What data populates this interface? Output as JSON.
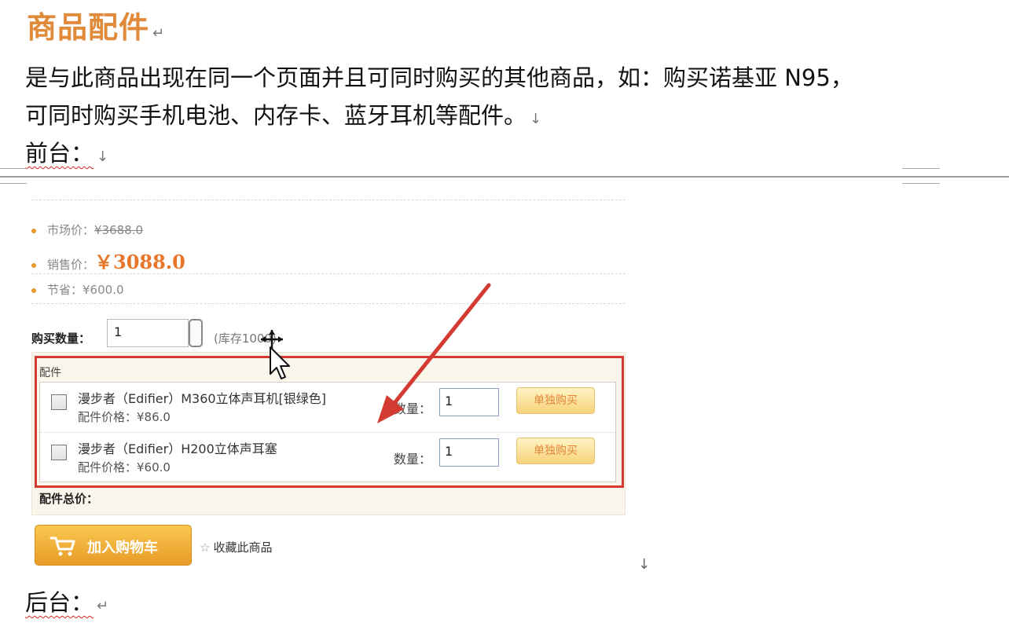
{
  "doc": {
    "heading": "商品配件",
    "para_line1": "是与此商品出现在同一个页面并且可同时购买的其他商品，如：购买诺基亚 N95，",
    "para_line2": "可同时购买手机电池、内存卡、蓝牙耳机等配件。",
    "front_label": "前台：",
    "back_label": "后台：",
    "mark_return": "↵",
    "mark_down": "↓"
  },
  "product": {
    "market_price_label": "市场价：",
    "market_price": "¥3688.0",
    "sale_price_label": "销售价：",
    "sale_price": "￥3088.0",
    "save_label": "节省：",
    "save_value": "¥600.0",
    "qty_label": "购买数量：",
    "qty_value": "1",
    "stock": "(库存1000)"
  },
  "accessories": {
    "title": "配件",
    "items": [
      {
        "name": "漫步者（Edifier）M360立体声耳机[银绿色]",
        "price_label": "配件价格：",
        "price": "¥86.0",
        "qty_label": "数量：",
        "qty": "1",
        "buy_label": "单独购买"
      },
      {
        "name": "漫步者（Edifier）H200立体声耳塞",
        "price_label": "配件价格：",
        "price": "¥60.0",
        "qty_label": "数量：",
        "qty": "1",
        "buy_label": "单独购买"
      }
    ],
    "total_label": "配件总价："
  },
  "actions": {
    "cart_label": "加入购物车",
    "fav_label": "收藏此商品"
  },
  "colors": {
    "heading": "#e08a3a",
    "price": "#e8762a",
    "highlight": "#d23a32",
    "button": "#f0b23c"
  },
  "icons": [
    "return-mark-icon",
    "down-arrow-mark-icon",
    "cart-icon",
    "star-icon",
    "mouse-cursor-icon",
    "annotation-arrow-icon"
  ]
}
